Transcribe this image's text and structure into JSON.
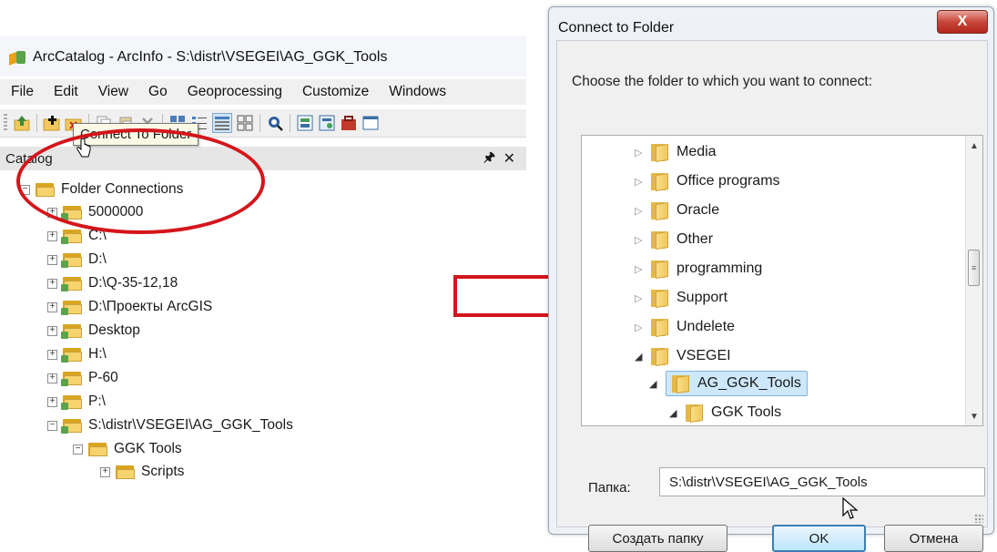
{
  "arccatalog": {
    "title": "ArcCatalog - ArcInfo - S:\\distr\\VSEGEI\\AG_GGK_Tools",
    "menu": [
      "File",
      "Edit",
      "View",
      "Go",
      "Geoprocessing",
      "Customize",
      "Windows"
    ],
    "catalog_panel_title": "Catalog",
    "pin_symbol": "↕",
    "close_symbol": "✕",
    "tooltip": "Connect To Folder",
    "tree": [
      {
        "label": "Folder Connections",
        "level": 0,
        "expanded": true
      },
      {
        "label": "5000000",
        "level": 1,
        "expanded": false
      },
      {
        "label": "C:\\",
        "level": 1,
        "expanded": false
      },
      {
        "label": "D:\\",
        "level": 1,
        "expanded": false
      },
      {
        "label": "D:\\Q-35-12,18",
        "level": 1,
        "expanded": false
      },
      {
        "label": "D:\\Проекты ArcGIS",
        "level": 1,
        "expanded": false
      },
      {
        "label": "Desktop",
        "level": 1,
        "expanded": false
      },
      {
        "label": "H:\\",
        "level": 1,
        "expanded": false
      },
      {
        "label": "P-60",
        "level": 1,
        "expanded": false
      },
      {
        "label": "P:\\",
        "level": 1,
        "expanded": false
      },
      {
        "label": "S:\\distr\\VSEGEI\\AG_GGK_Tools",
        "level": 1,
        "expanded": true
      },
      {
        "label": "GGK Tools",
        "level": 2,
        "expanded": true
      },
      {
        "label": "Scripts",
        "level": 3,
        "expanded": false
      }
    ]
  },
  "dialog": {
    "title": "Connect to Folder",
    "close_symbol": "X",
    "prompt": "Choose the folder to which you want to connect:",
    "tree": [
      {
        "label": "Media",
        "expanded": false,
        "level": 0
      },
      {
        "label": "Office programs",
        "expanded": false,
        "level": 0
      },
      {
        "label": "Oracle",
        "expanded": false,
        "level": 0
      },
      {
        "label": "Other",
        "expanded": false,
        "level": 0
      },
      {
        "label": "programming",
        "expanded": false,
        "level": 0
      },
      {
        "label": "Support",
        "expanded": false,
        "level": 0
      },
      {
        "label": "Undelete",
        "expanded": false,
        "level": 0
      },
      {
        "label": "VSEGEI",
        "expanded": true,
        "level": 0
      },
      {
        "label": "AG_GGK_Tools",
        "expanded": true,
        "level": 1,
        "selected": true
      },
      {
        "label": "GGK Tools",
        "expanded": true,
        "level": 2
      }
    ],
    "folder_label": "Папка:",
    "folder_value": "S:\\distr\\VSEGEI\\AG_GGK_Tools",
    "new_folder_button": "Создать папку",
    "ok_button": "OK",
    "cancel_button": "Отмена"
  },
  "colors": {
    "highlight_ellipse": "#d4151b",
    "selection": "#cde8fb"
  }
}
